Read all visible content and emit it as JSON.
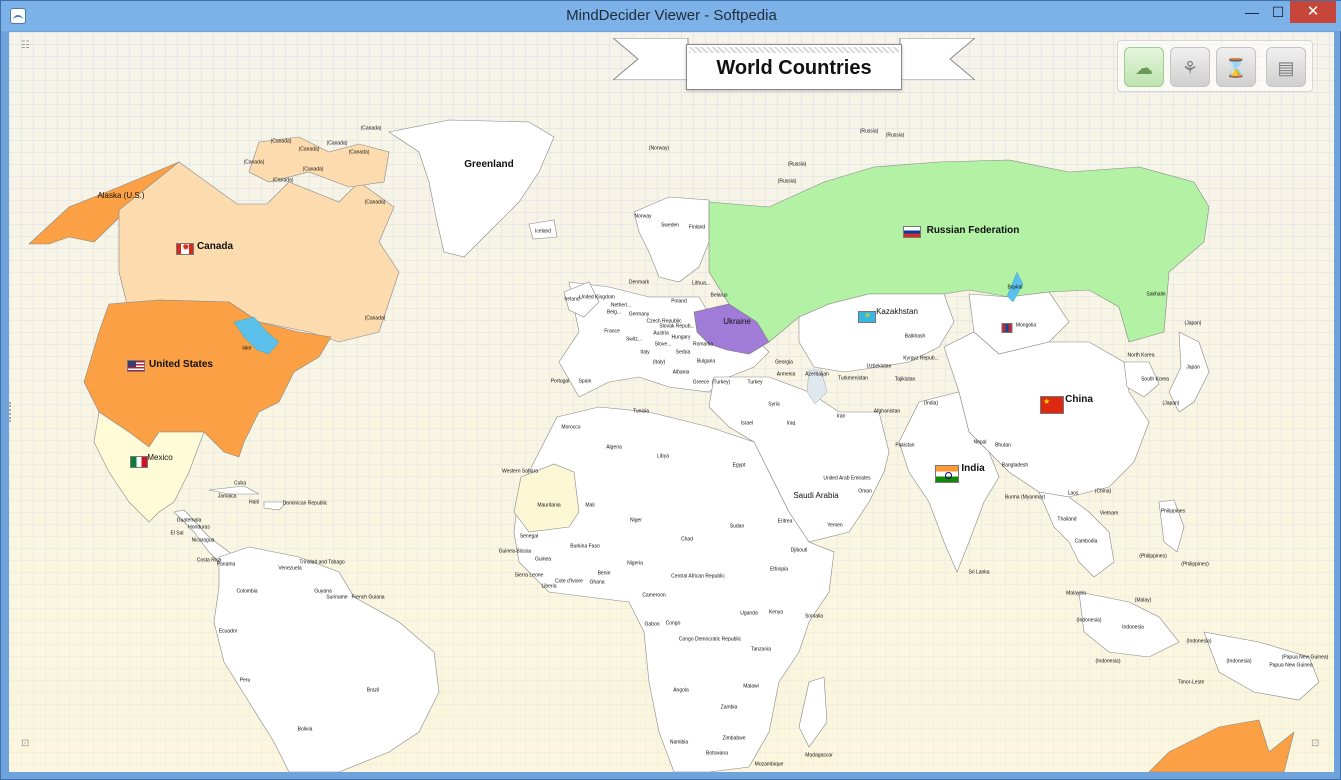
{
  "window": {
    "title": "MindDecider Viewer - Softpedia",
    "controls": {
      "minimize": "—",
      "maximize": "☐",
      "close": "✕"
    }
  },
  "map": {
    "title": "World Countries",
    "toolbar": [
      {
        "name": "cloud-map-tool",
        "icon": "☁",
        "active": true
      },
      {
        "name": "tree-tool",
        "icon": "⚘",
        "active": false
      },
      {
        "name": "hourglass-tool",
        "icon": "⌛",
        "active": false
      },
      {
        "name": "document-tool",
        "icon": "▤",
        "active": false
      }
    ],
    "highlight_colors": {
      "canada": "#fcdcae",
      "united_states": "#fba044",
      "alaska": "#fba044",
      "mexico": "#fffbd6",
      "russia": "#b3f1a5",
      "ukraine": "#a07cd8",
      "mauritania": "#fcf8d6",
      "lakes": "#5bc0ec"
    },
    "labels": {
      "alaska": "Alaska (U.S.)",
      "canada": "Canada",
      "united_states": "United States",
      "mexico": "Mexico",
      "lake": "lake",
      "greenland": "Greenland",
      "iceland": "Iceland",
      "norway_paren": "(Norway)",
      "norway": "Norway",
      "sweden": "Sweden",
      "finland": "Finland",
      "russia_1": "(Russia)",
      "russia_2": "(Russia)",
      "russia_3": "(Russia)",
      "russia_4": "(Russia)",
      "russian_federation": "Russian Federation",
      "baykal": "Baykal",
      "sakhalin": "Sakhalin",
      "japan_1": "(Japan)",
      "japan": "Japan",
      "japan_2": "(Japan)",
      "north_korea": "North Korea",
      "south_korea": "South Korea",
      "kazakhstan": "Kazakhstan",
      "balkhash": "Balkhash",
      "mongolia": "Mongolia",
      "china": "China",
      "china_paren": "(China)",
      "india": "India",
      "india_paren": "(India)",
      "denmark": "Denmark",
      "lithuania": "Lithua...",
      "belarus": "Belarus",
      "poland": "Poland",
      "ireland": "Ireland",
      "united_kingdom": "United Kingdom",
      "netherlands": "Netherl...",
      "belgium": "Belg...",
      "germany": "Germany",
      "czech_republic": "Czech Republic",
      "slovak_republic": "Slovak Repub...",
      "austria": "Austria",
      "hungary": "Hungary",
      "romania": "Romania",
      "ukraine": "Ukraine",
      "france": "France",
      "switzerland": "Switz...",
      "slovenia": "Slove...",
      "italy": "Italy",
      "italy_paren": "(Italy)",
      "serbia": "Serbia",
      "bulgaria": "Bulgaria",
      "albania": "Albania",
      "greece": "Greece",
      "turkey_paren": "(Turkey)",
      "portugal": "Portugal",
      "spain": "Spain",
      "georgia": "Georgia",
      "armenia": "Armenia",
      "azerbaijan": "Azerbaijan",
      "turkey": "Turkey",
      "turkmenistan": "Turkmenistan",
      "uzbekistan": "Uzbekistan",
      "kyrgyz_republic": "Kyrgyz Repub...",
      "tajikistan": "Tajikistan",
      "syria": "Syria",
      "iraq": "Iraq",
      "iran": "Iran",
      "afghanistan": "Afghanistan",
      "pakistan": "Pakistan",
      "israel": "Israel",
      "nepal": "Nepal",
      "bhutan": "Bhutan",
      "bangladesh": "Bangladesh",
      "burma": "Burma (Myanmar)",
      "laos": "Laos",
      "thailand": "Thailand",
      "vietnam": "Vietnam",
      "cambodia": "Cambodia",
      "philippines": "Philippines",
      "philippines_1": "(Philippines)",
      "philippines_2": "(Philippines)",
      "sri_lanka": "Sri Lanka",
      "malaysia": "Malaysia",
      "malaysia_paren": "(Malay)",
      "indonesia": "Indonesia",
      "indonesia_1": "(Indonesia)",
      "indonesia_2": "(Indonesia)",
      "indonesia_3": "(Indonesia)",
      "indonesia_4": "(Indonesia)",
      "papua_new_guinea": "Papua New Guinea",
      "papua_new_guinea_paren": "(Papua New Guinea)",
      "timor_leste": "Timor-Leste",
      "saudi_arabia": "Saudi Arabia",
      "uae": "United Arab Emirates",
      "oman": "Oman",
      "yemen": "Yemen",
      "egypt": "Egypt",
      "libya": "Libya",
      "tunisia": "Tunisia",
      "algeria": "Algeria",
      "morocco": "Morocco",
      "western_sahara": "Western Sahara",
      "mauritania": "Mauritania",
      "mali": "Mali",
      "niger": "Niger",
      "chad": "Chad",
      "sudan": "Sudan",
      "eritrea": "Eritrea",
      "djibouti": "Djibouti",
      "ethiopia": "Ethiopia",
      "senegal": "Senegal",
      "guinea_bissau": "Guinea-Bissau",
      "guinea": "Guinea",
      "sierra_leone": "Sierra Leone",
      "liberia": "Liberia",
      "cote_divoire": "Cote d'Ivoire",
      "ghana": "Ghana",
      "burkina_faso": "Burkina Faso",
      "benin": "Benin",
      "nigeria": "Nigeria",
      "cameroon": "Cameroon",
      "central_african_republic": "Central African Republic",
      "gabon": "Gabon",
      "congo": "Congo",
      "congo_dr": "Congo Democratic Republic",
      "uganda": "Uganda",
      "kenya": "Kenya",
      "somalia": "Somalia",
      "tanzania": "Tanzania",
      "angola": "Angola",
      "zambia": "Zambia",
      "malawi": "Malawi",
      "namibia": "Namibia",
      "botswana": "Botswana",
      "zimbabwe": "Zimbabwe",
      "madagascar": "Madagascar",
      "mozambique": "Mozambique",
      "cuba": "Cuba",
      "jamaica": "Jamaica",
      "haiti": "Haiti",
      "dominican_republic": "Dominican Republic",
      "guatemala": "Guatemala",
      "honduras": "Honduras",
      "el_salvador": "El Sal",
      "nicaragua": "Nicaragua",
      "costa_rica": "Costa Rica",
      "panama": "Panama",
      "trinidad": "Trinidad and Tobago",
      "venezuela": "Venezuela",
      "colombia": "Colombia",
      "guyana": "Guyana",
      "suriname": "Suriname",
      "french_guiana": "French Guiana",
      "ecuador": "Ecuador",
      "peru": "Peru",
      "brazil": "Brazil",
      "bolivia": "Bolivia",
      "canada_isl_1": "(Canada)",
      "canada_isl_2": "(Canada)",
      "canada_isl_3": "(Canada)",
      "canada_isl_4": "(Canada)",
      "canada_isl_5": "(Canada)",
      "canada_isl_6": "(Canada)",
      "canada_isl_7": "(Canada)",
      "canada_isl_8": "(Canada)",
      "canada_isl_9": "(Canada)",
      "canada_isl_10": "(Canada)"
    }
  },
  "corners": {
    "top_left": "☷",
    "bottom_left": "⊡",
    "bottom_right": "⊡"
  }
}
